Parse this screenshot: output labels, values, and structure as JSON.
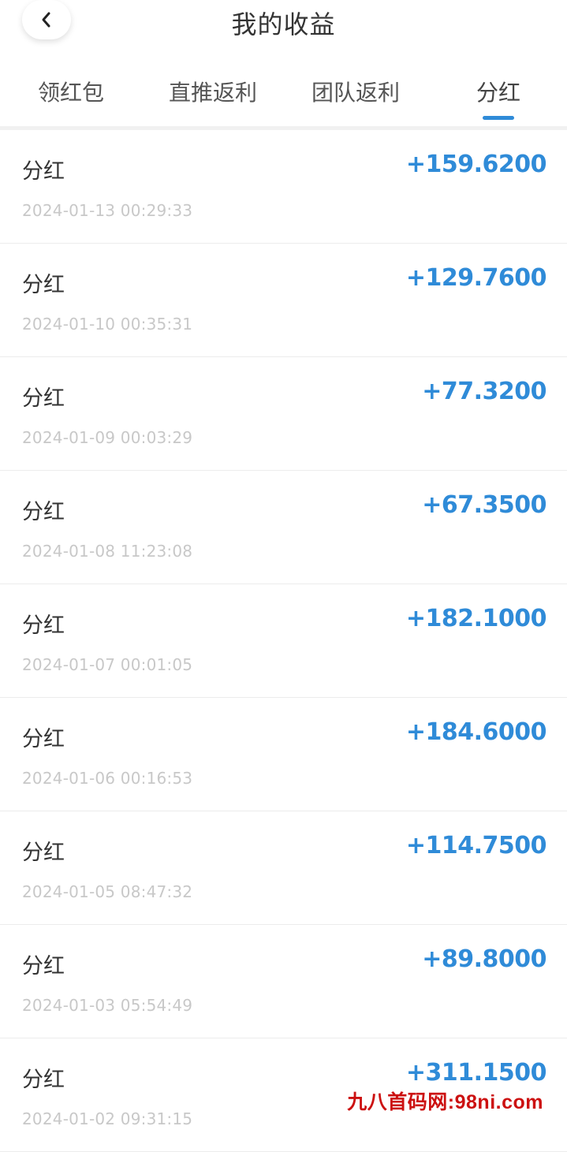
{
  "header": {
    "title": "我的收益",
    "back_icon": "chevron-left-icon"
  },
  "tabs": [
    {
      "label": "领红包",
      "active": false
    },
    {
      "label": "直推返利",
      "active": false
    },
    {
      "label": "团队返利",
      "active": false
    },
    {
      "label": "分红",
      "active": true
    }
  ],
  "colors": {
    "accent": "#2f8bd8",
    "title_text": "#333333",
    "date_text": "#c8c8c8",
    "watermark": "#cc1111"
  },
  "records": [
    {
      "title": "分红",
      "date": "2024-01-13 00:29:33",
      "amount": "+159.6200"
    },
    {
      "title": "分红",
      "date": "2024-01-10 00:35:31",
      "amount": "+129.7600"
    },
    {
      "title": "分红",
      "date": "2024-01-09 00:03:29",
      "amount": "+77.3200"
    },
    {
      "title": "分红",
      "date": "2024-01-08 11:23:08",
      "amount": "+67.3500"
    },
    {
      "title": "分红",
      "date": "2024-01-07 00:01:05",
      "amount": "+182.1000"
    },
    {
      "title": "分红",
      "date": "2024-01-06 00:16:53",
      "amount": "+184.6000"
    },
    {
      "title": "分红",
      "date": "2024-01-05 08:47:32",
      "amount": "+114.7500"
    },
    {
      "title": "分红",
      "date": "2024-01-03 05:54:49",
      "amount": "+89.8000"
    },
    {
      "title": "分红",
      "date": "2024-01-02 09:31:15",
      "amount": "+311.1500"
    }
  ],
  "watermark": "九八首码网:98ni.com"
}
